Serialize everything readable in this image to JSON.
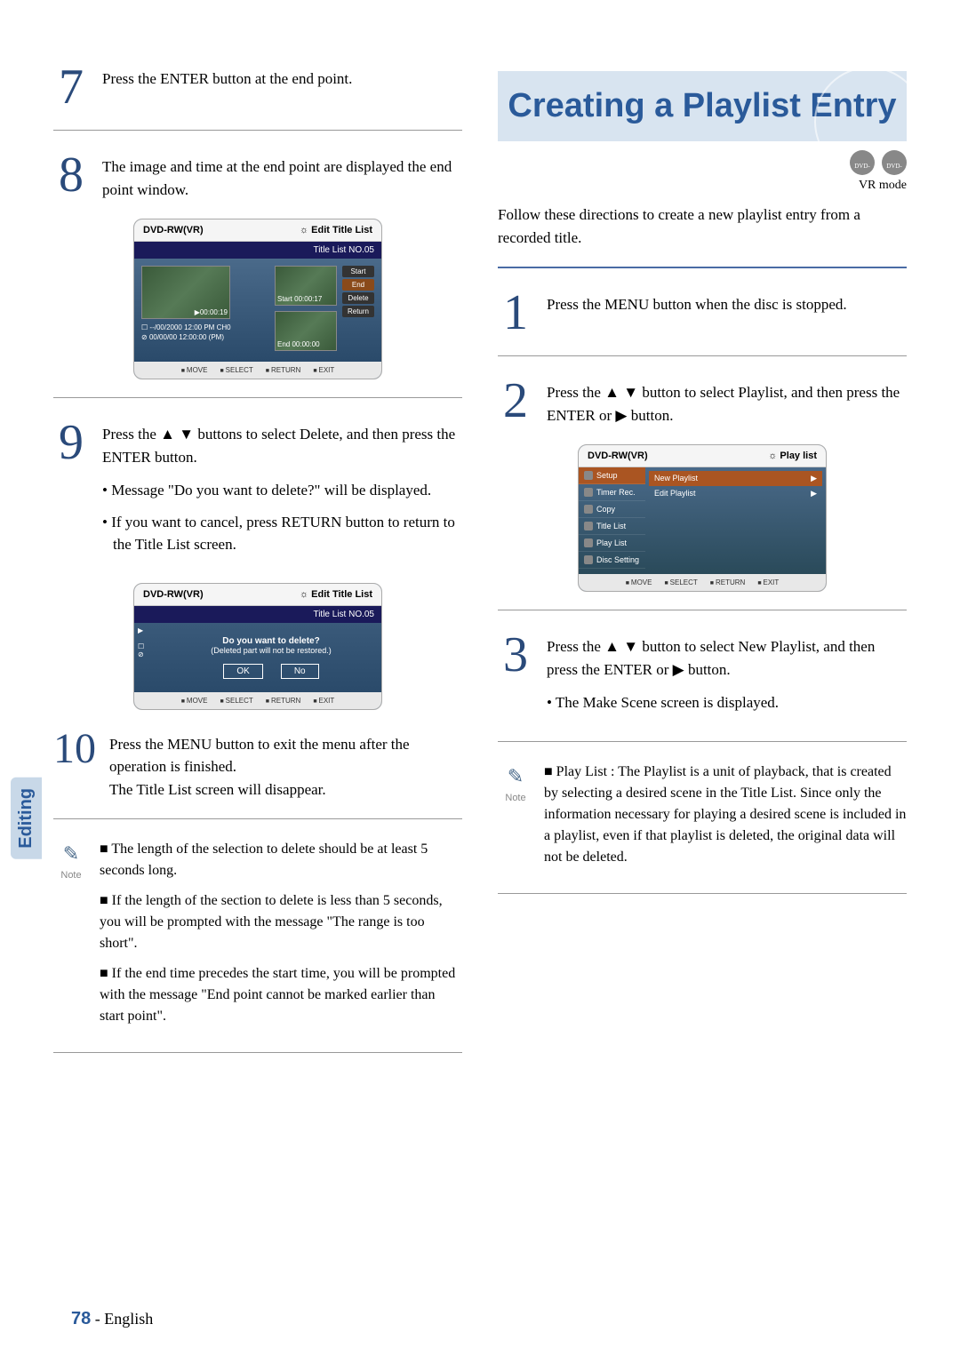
{
  "sideTab": "Editing",
  "pageNumber": "78",
  "pageLang": "English",
  "rightTitle": "Creating a Playlist Entry",
  "modeBadges": [
    "DVD-RAM",
    "DVD-RW"
  ],
  "modeText": "VR mode",
  "introRight": "Follow these directions to create a new playlist entry from a recorded title.",
  "steps": {
    "s7": "Press the ENTER button at the end point.",
    "s8": "The image and time at the end point are displayed the end point window.",
    "s9_main": "Press the ▲ ▼ buttons to select Delete, and then press the ENTER button.",
    "s9_b1": "Message \"Do you want to delete?\" will be displayed.",
    "s9_b2": "If you want to cancel, press RETURN button to return to the Title List screen.",
    "s10_a": "Press the MENU button to exit the menu after the operation is finished.",
    "s10_b": "The Title List screen will disappear.",
    "r1": "Press the MENU button when the disc is stopped.",
    "r2": "Press the ▲ ▼ button to select Playlist, and then press the ENTER or ▶ button.",
    "r3_a": "Press the ▲ ▼ button to select New Playlist, and then press the ENTER or ▶ button.",
    "r3_b": "The Make Scene screen is displayed."
  },
  "notes": {
    "left_n1": "The length of the selection to delete should be at least 5 seconds long.",
    "left_n2": "If the length of the section to delete is less than 5 seconds, you will be prompted with the message \"The range is too short\".",
    "left_n3": "If the end time precedes the start time, you will be prompted with the message \"End point cannot be marked earlier than start point\".",
    "right_n1": "Play List : The Playlist is a unit of playback, that is created by selecting a desired scene in the Title List. Since only the information necessary for playing a desired scene is included in a playlist, even if that playlist is deleted, the original data will not be deleted.",
    "noteLabel": "Note"
  },
  "screenshots": {
    "s8": {
      "headerLeft": "DVD-RW(VR)",
      "headerRight": "Edit Title List",
      "titlebar": "Title List NO.05",
      "playTime": "00:00:19",
      "line1": "--/00/2000 12:00 PM CH0",
      "line2": "00/00/00 12:00:00 (PM)",
      "startLabel": "Start",
      "startTime": "00:00:17",
      "endLabel": "End",
      "endTime": "00:00:00",
      "btns": [
        "Start",
        "End",
        "Delete",
        "Return"
      ],
      "footer": [
        "MOVE",
        "SELECT",
        "RETURN",
        "EXIT"
      ]
    },
    "s9": {
      "headerLeft": "DVD-RW(VR)",
      "headerRight": "Edit Title List",
      "titlebar": "Title List NO.05",
      "dialogLine1": "Do you want to delete?",
      "dialogLine2": "(Deleted part will not be restored.)",
      "ok": "OK",
      "no": "No",
      "footer": [
        "MOVE",
        "SELECT",
        "RETURN",
        "EXIT"
      ]
    },
    "r2": {
      "headerLeft": "DVD-RW(VR)",
      "headerRight": "Play list",
      "menuLeft": [
        "Setup",
        "Timer Rec.",
        "Copy",
        "Title List",
        "Play List",
        "Disc Setting"
      ],
      "menuRight": [
        "New Playlist",
        "Edit Playlist"
      ],
      "footer": [
        "MOVE",
        "SELECT",
        "RETURN",
        "EXIT"
      ]
    }
  }
}
